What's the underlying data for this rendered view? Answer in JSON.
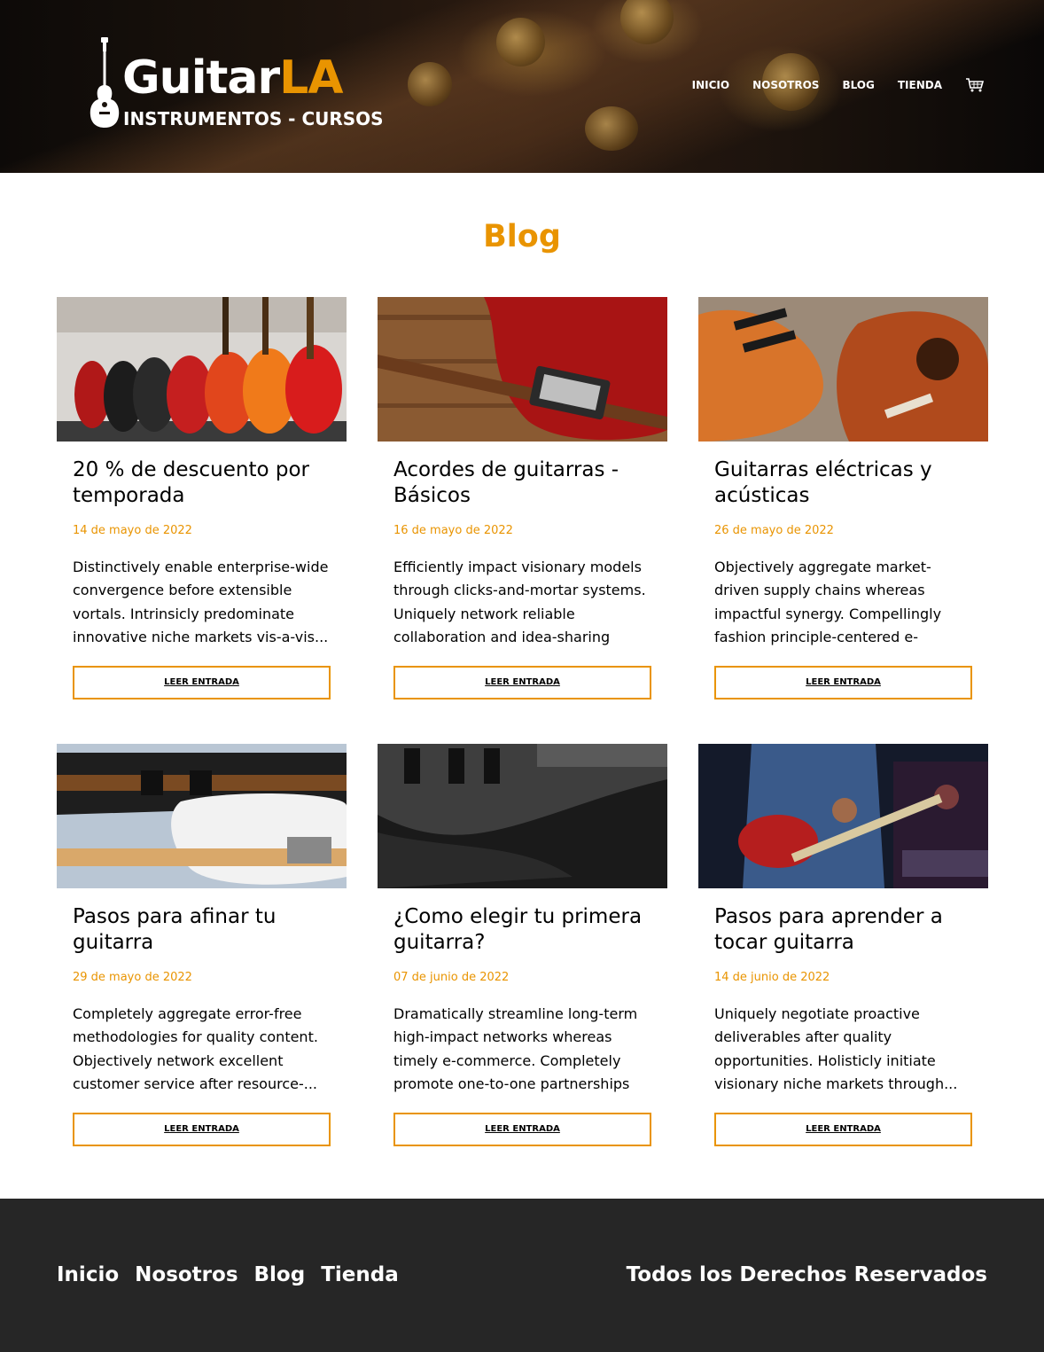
{
  "header": {
    "logo": {
      "title_white": "Guitar",
      "title_orange": "LA",
      "subtitle": "INSTRUMENTOS - CURSOS"
    },
    "nav": [
      "INICIO",
      "NOSOTROS",
      "BLOG",
      "TIENDA"
    ],
    "cart_icon": "cart-icon"
  },
  "main": {
    "heading": "Blog",
    "posts": [
      {
        "title": "20 % de descuento por temporada",
        "date": "14 de mayo de 2022",
        "excerpt": "Distinctively enable enterprise-wide convergence before extensible vortals. Intrinsicly predominate innovative niche markets vis-a-vis...",
        "button": "LEER ENTRADA"
      },
      {
        "title": "Acordes de guitarras - Básicos",
        "date": "16 de mayo de 2022",
        "excerpt": "Efficiently impact visionary models through clicks-and-mortar systems. Uniquely network reliable collaboration and idea-sharing vis-...",
        "button": "LEER ENTRADA"
      },
      {
        "title": "Guitarras eléctricas y acústicas",
        "date": "26 de mayo de 2022",
        "excerpt": "Objectively aggregate market-driven supply chains whereas impactful synergy. Compellingly fashion principle-centered e-business vis-a...",
        "button": "LEER ENTRADA"
      },
      {
        "title": "Pasos para afinar tu guitarra",
        "date": "29 de mayo de 2022",
        "excerpt": "Completely aggregate error-free methodologies for quality content. Objectively network excellent customer service after resource-...",
        "button": "LEER ENTRADA"
      },
      {
        "title": "¿Como elegir tu primera guitarra?",
        "date": "07 de junio de 2022",
        "excerpt": "Dramatically streamline long-term high-impact networks whereas timely e-commerce. Completely promote one-to-one partnerships rather tha...",
        "button": "LEER ENTRADA"
      },
      {
        "title": "Pasos para aprender a tocar guitarra",
        "date": "14 de junio de 2022",
        "excerpt": "Uniquely negotiate proactive deliverables after quality opportunities. Holisticly initiate visionary niche markets through...",
        "button": "LEER ENTRADA"
      }
    ]
  },
  "footer": {
    "nav": [
      "Inicio",
      "Nosotros",
      "Blog",
      "Tienda"
    ],
    "copyright": "Todos los Derechos Reservados"
  },
  "colors": {
    "accent": "#e99401",
    "footer_bg": "#262626"
  }
}
